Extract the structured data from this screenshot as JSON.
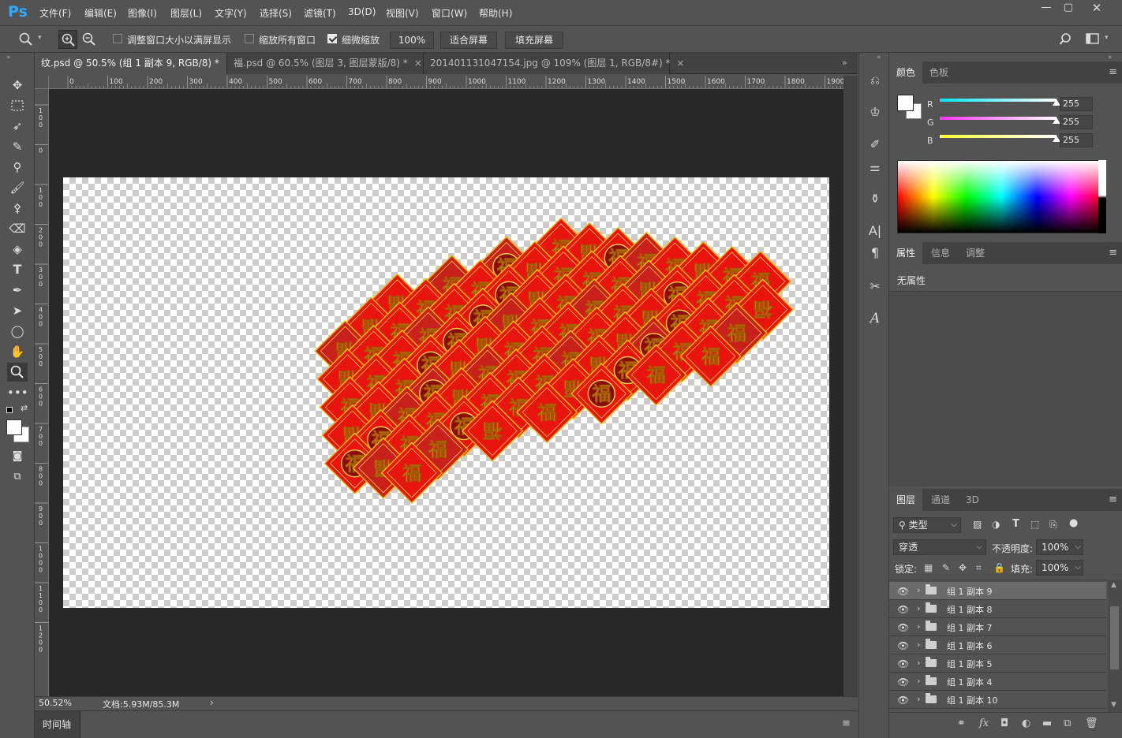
{
  "app": {
    "logo": "Ps"
  },
  "menu": [
    "文件(F)",
    "编辑(E)",
    "图像(I)",
    "图层(L)",
    "文字(Y)",
    "选择(S)",
    "滤镜(T)",
    "3D(D)",
    "视图(V)",
    "窗口(W)",
    "帮助(H)"
  ],
  "options": {
    "resize_windows": "调整窗口大小以满屏显示",
    "zoom_all": "缩放所有窗口",
    "scrubby_zoom": "细微缩放",
    "zoom_value": "100%",
    "fit_screen": "适合屏幕",
    "fill_screen": "填充屏幕"
  },
  "tabs": [
    {
      "label": "纹.psd @ 50.5% (组 1 副本 9, RGB/8) *",
      "active": true
    },
    {
      "label": "福.psd @ 60.5% (图层 3, 图层蒙版/8) *",
      "active": false
    },
    {
      "label": "201401131047154.jpg @ 109% (图层 1, RGB/8#) *",
      "active": false
    }
  ],
  "ruler": {
    "h": [
      "0",
      "100",
      "200",
      "300",
      "400",
      "500",
      "600",
      "700",
      "800",
      "900",
      "1000",
      "1100",
      "1200",
      "1300",
      "1400",
      "1500",
      "1600",
      "1700",
      "1800",
      "1900"
    ],
    "v": [
      "1\n0\n0",
      "0",
      "1\n0\n0",
      "2\n0\n0",
      "3\n0\n0",
      "4\n0\n0",
      "5\n0\n0",
      "6\n0\n0",
      "7\n0\n0",
      "8\n0\n0",
      "9\n0\n0",
      "1\n0\n0\n0",
      "1\n1\n0\n0",
      "1\n2\n0\n0"
    ]
  },
  "artwork": {
    "glyph_fu": "福",
    "glyph_fu_inverted": "福"
  },
  "status": {
    "zoom": "50.52%",
    "doc": "文档:5.93M/85.3M",
    "arrow": "›"
  },
  "timeline": {
    "label": "时间轴"
  },
  "color_panel": {
    "tabs": [
      "颜色",
      "色板"
    ],
    "channels": [
      {
        "label": "R",
        "value": "255",
        "level": 1.0
      },
      {
        "label": "G",
        "value": "255",
        "level": 1.0
      },
      {
        "label": "B",
        "value": "255",
        "level": 1.0
      }
    ],
    "colors": {
      "r_track": "#00e5ff",
      "g_track": "#ff33ff",
      "b_track": "#ffff33"
    }
  },
  "properties_panel": {
    "tabs": [
      "属性",
      "信息",
      "调整"
    ],
    "empty": "无属性"
  },
  "layers_panel": {
    "tabs": [
      "图层",
      "通道",
      "3D"
    ],
    "filter_kind": "类型",
    "blend_mode": "穿透",
    "opacity_label": "不透明度:",
    "opacity": "100%",
    "lock_label": "锁定:",
    "fill_label": "填充:",
    "fill": "100%",
    "layers": [
      {
        "name": "组 1 副本 9",
        "selected": true
      },
      {
        "name": "组 1 副本 8",
        "selected": false
      },
      {
        "name": "组 1 副本 7",
        "selected": false
      },
      {
        "name": "组 1 副本 6",
        "selected": false
      },
      {
        "name": "组 1 副本 5",
        "selected": false
      },
      {
        "name": "组 1 副本 4",
        "selected": false
      },
      {
        "name": "组 1 副本 10",
        "selected": false
      }
    ]
  }
}
